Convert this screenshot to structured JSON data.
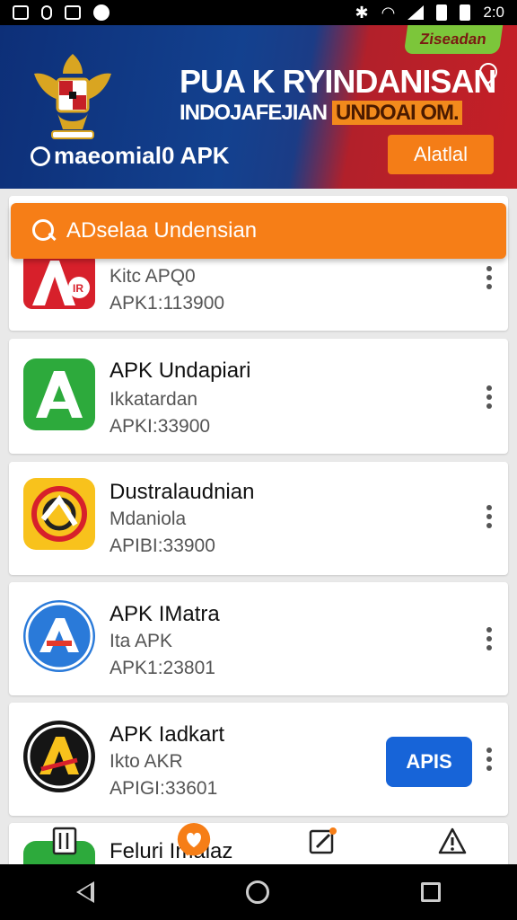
{
  "status_bar": {
    "time": "2:0",
    "left_icons": [
      "image-icon",
      "clip-icon",
      "gallery-icon",
      "location-icon"
    ],
    "right_icons": [
      "bluetooth-icon",
      "wifi-icon",
      "signal-icon",
      "battery-icon"
    ]
  },
  "banner": {
    "tag": "Ziseadan",
    "title": "PUA K RYINDANISAN",
    "subtitle": "INDOJAFEJIAN",
    "subtitle_highlight": "UNDOAI OM.",
    "brand": "maeomial0 APK",
    "action_label": "Alatlal"
  },
  "search": {
    "placeholder": "ADselaa Undensian"
  },
  "apps": [
    {
      "name": "",
      "subtitle": "Kitc APQ0",
      "version": "APK1:113900",
      "icon": "a-red-icon",
      "icon_color": "#d7202b"
    },
    {
      "name": "APK Undapiari",
      "subtitle": "Ikkatardan",
      "version": "APKI:33900",
      "icon": "a-green-icon",
      "icon_color": "#2daa3c"
    },
    {
      "name": "Dustralaudnian",
      "subtitle": "Mdaniola",
      "version": "APIBI:33900",
      "icon": "aim-yellow-icon",
      "icon_color": "#f8c21c"
    },
    {
      "name": "APK IMatra",
      "subtitle": "Ita APK",
      "version": "APK1:23801",
      "icon": "a-blue-circle-icon",
      "icon_color": "#2a7ad9"
    },
    {
      "name": "APK Iadkart",
      "subtitle": "Ikto AKR",
      "version": "APIGI:33601",
      "icon": "a-dark-circle-icon",
      "icon_color": "#151515",
      "install_label": "APIS"
    },
    {
      "name": "Feluri Imaiaz",
      "subtitle": "",
      "version": "",
      "icon": "green-partial-icon",
      "icon_color": "#2daa3c"
    }
  ],
  "tabs": [
    "library-tab",
    "favorites-tab",
    "edit-tab",
    "alerts-tab"
  ],
  "colors": {
    "accent": "#f67e17",
    "brand_blue": "#13418f",
    "brand_red": "#c61f26",
    "install_blue": "#1764d8"
  }
}
